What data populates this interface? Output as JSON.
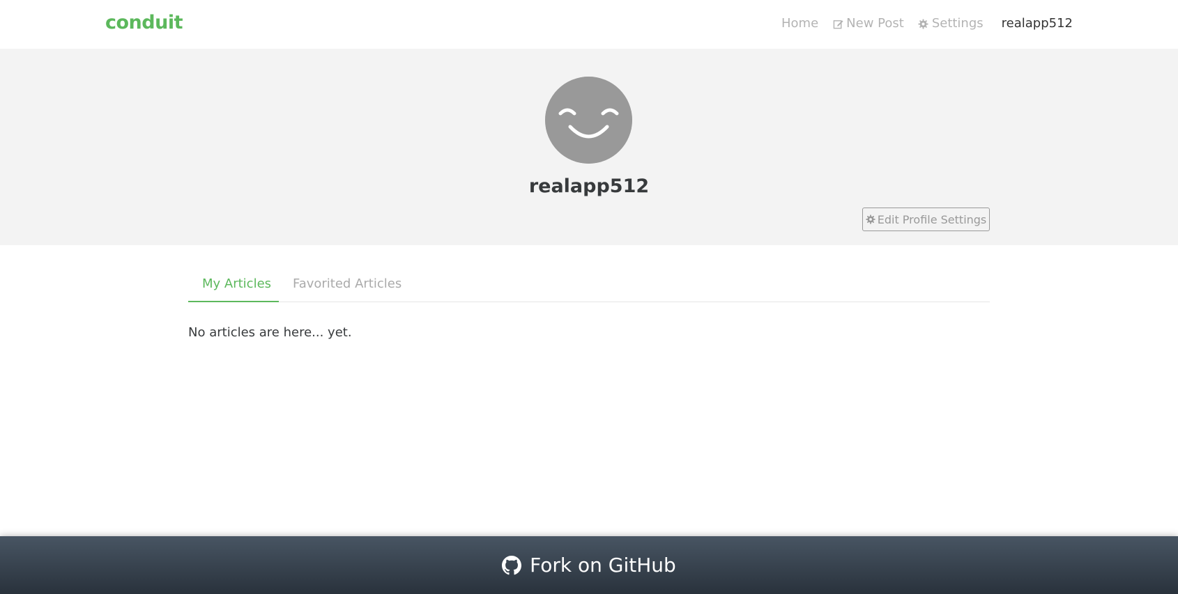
{
  "navbar": {
    "brand": "conduit",
    "items": [
      {
        "label": "Home",
        "icon": ""
      },
      {
        "label": "New Post",
        "icon": "edit-icon"
      },
      {
        "label": "Settings",
        "icon": "gear-icon"
      },
      {
        "label": "realapp512",
        "icon": ""
      }
    ]
  },
  "profile": {
    "avatar": "smiley-avatar",
    "username": "realapp512",
    "edit_button": "Edit Profile Settings"
  },
  "tabs": [
    {
      "label": "My Articles",
      "active": true
    },
    {
      "label": "Favorited Articles",
      "active": false
    }
  ],
  "articles": {
    "empty_message": "No articles are here... yet."
  },
  "footer": {
    "label": "Fork on GitHub",
    "icon": "github-icon"
  },
  "colors": {
    "brand": "#5cb85c",
    "banner": "#f3f3f3",
    "footer_top": "#485563",
    "footer_bottom": "#29323c"
  }
}
